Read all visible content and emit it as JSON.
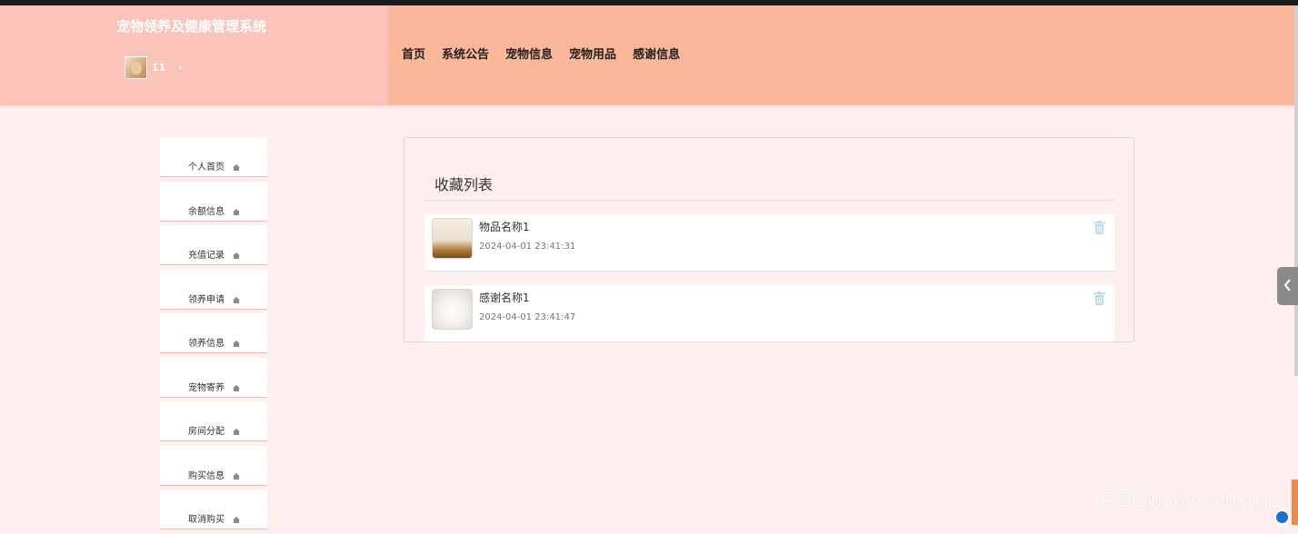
{
  "header": {
    "site_title": "宠物领养及健康管理系统",
    "user_name": "11",
    "user_caret": "▾"
  },
  "nav": [
    {
      "label": "首页"
    },
    {
      "label": "系统公告"
    },
    {
      "label": "宠物信息"
    },
    {
      "label": "宠物用品"
    },
    {
      "label": "感谢信息"
    }
  ],
  "sidebar": {
    "icon": "home-icon",
    "items": [
      {
        "label": "个人首页"
      },
      {
        "label": "余额信息"
      },
      {
        "label": "充值记录"
      },
      {
        "label": "领养申请"
      },
      {
        "label": "领养信息"
      },
      {
        "label": "宠物寄养"
      },
      {
        "label": "房间分配"
      },
      {
        "label": "购买信息"
      },
      {
        "label": "取消购买"
      }
    ]
  },
  "favorites": {
    "title": "收藏列表",
    "items": [
      {
        "name": "物品名称1",
        "time": "2024-04-01 23:41:31"
      },
      {
        "name": "感谢名称1",
        "time": "2024-04-01 23:41:47"
      }
    ]
  },
  "watermark": "CSDN @yuyuxun1",
  "colors": {
    "header_left": "#fbc3b9",
    "header_right": "#fbb799",
    "page_bg": "#ffefef",
    "sidebar_border": "#f7b8a8",
    "trash_icon": "#b9dde8"
  }
}
